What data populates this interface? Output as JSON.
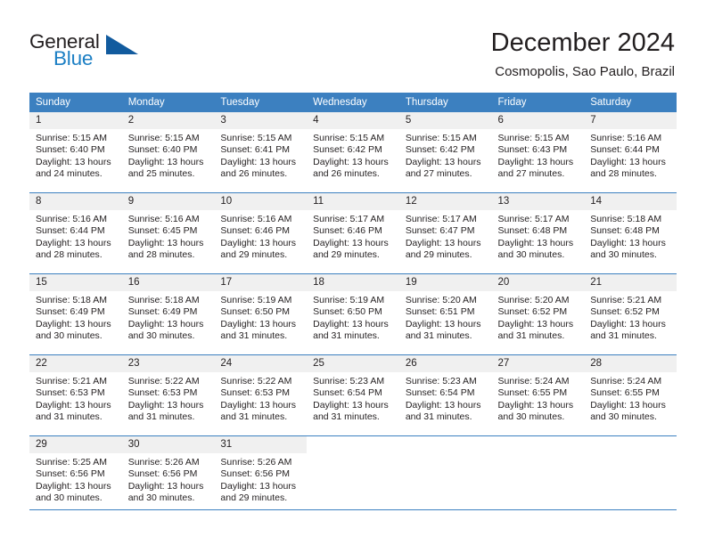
{
  "logo": {
    "word_one": "General",
    "word_two": "Blue",
    "triangle_color": "#125b9e",
    "blue_color": "#1c7fc4"
  },
  "header": {
    "title": "December 2024",
    "subtitle": "Cosmopolis, Sao Paulo, Brazil"
  },
  "theme": {
    "header_bg": "#3c80c0",
    "daynum_bg": "#f0f0f0",
    "text": "#231f20"
  },
  "weekday_headers": [
    "Sunday",
    "Monday",
    "Tuesday",
    "Wednesday",
    "Thursday",
    "Friday",
    "Saturday"
  ],
  "weeks": [
    [
      {
        "day": "1",
        "sunrise": "Sunrise: 5:15 AM",
        "sunset": "Sunset: 6:40 PM",
        "daylight1": "Daylight: 13 hours",
        "daylight2": "and 24 minutes."
      },
      {
        "day": "2",
        "sunrise": "Sunrise: 5:15 AM",
        "sunset": "Sunset: 6:40 PM",
        "daylight1": "Daylight: 13 hours",
        "daylight2": "and 25 minutes."
      },
      {
        "day": "3",
        "sunrise": "Sunrise: 5:15 AM",
        "sunset": "Sunset: 6:41 PM",
        "daylight1": "Daylight: 13 hours",
        "daylight2": "and 26 minutes."
      },
      {
        "day": "4",
        "sunrise": "Sunrise: 5:15 AM",
        "sunset": "Sunset: 6:42 PM",
        "daylight1": "Daylight: 13 hours",
        "daylight2": "and 26 minutes."
      },
      {
        "day": "5",
        "sunrise": "Sunrise: 5:15 AM",
        "sunset": "Sunset: 6:42 PM",
        "daylight1": "Daylight: 13 hours",
        "daylight2": "and 27 minutes."
      },
      {
        "day": "6",
        "sunrise": "Sunrise: 5:15 AM",
        "sunset": "Sunset: 6:43 PM",
        "daylight1": "Daylight: 13 hours",
        "daylight2": "and 27 minutes."
      },
      {
        "day": "7",
        "sunrise": "Sunrise: 5:16 AM",
        "sunset": "Sunset: 6:44 PM",
        "daylight1": "Daylight: 13 hours",
        "daylight2": "and 28 minutes."
      }
    ],
    [
      {
        "day": "8",
        "sunrise": "Sunrise: 5:16 AM",
        "sunset": "Sunset: 6:44 PM",
        "daylight1": "Daylight: 13 hours",
        "daylight2": "and 28 minutes."
      },
      {
        "day": "9",
        "sunrise": "Sunrise: 5:16 AM",
        "sunset": "Sunset: 6:45 PM",
        "daylight1": "Daylight: 13 hours",
        "daylight2": "and 28 minutes."
      },
      {
        "day": "10",
        "sunrise": "Sunrise: 5:16 AM",
        "sunset": "Sunset: 6:46 PM",
        "daylight1": "Daylight: 13 hours",
        "daylight2": "and 29 minutes."
      },
      {
        "day": "11",
        "sunrise": "Sunrise: 5:17 AM",
        "sunset": "Sunset: 6:46 PM",
        "daylight1": "Daylight: 13 hours",
        "daylight2": "and 29 minutes."
      },
      {
        "day": "12",
        "sunrise": "Sunrise: 5:17 AM",
        "sunset": "Sunset: 6:47 PM",
        "daylight1": "Daylight: 13 hours",
        "daylight2": "and 29 minutes."
      },
      {
        "day": "13",
        "sunrise": "Sunrise: 5:17 AM",
        "sunset": "Sunset: 6:48 PM",
        "daylight1": "Daylight: 13 hours",
        "daylight2": "and 30 minutes."
      },
      {
        "day": "14",
        "sunrise": "Sunrise: 5:18 AM",
        "sunset": "Sunset: 6:48 PM",
        "daylight1": "Daylight: 13 hours",
        "daylight2": "and 30 minutes."
      }
    ],
    [
      {
        "day": "15",
        "sunrise": "Sunrise: 5:18 AM",
        "sunset": "Sunset: 6:49 PM",
        "daylight1": "Daylight: 13 hours",
        "daylight2": "and 30 minutes."
      },
      {
        "day": "16",
        "sunrise": "Sunrise: 5:18 AM",
        "sunset": "Sunset: 6:49 PM",
        "daylight1": "Daylight: 13 hours",
        "daylight2": "and 30 minutes."
      },
      {
        "day": "17",
        "sunrise": "Sunrise: 5:19 AM",
        "sunset": "Sunset: 6:50 PM",
        "daylight1": "Daylight: 13 hours",
        "daylight2": "and 31 minutes."
      },
      {
        "day": "18",
        "sunrise": "Sunrise: 5:19 AM",
        "sunset": "Sunset: 6:50 PM",
        "daylight1": "Daylight: 13 hours",
        "daylight2": "and 31 minutes."
      },
      {
        "day": "19",
        "sunrise": "Sunrise: 5:20 AM",
        "sunset": "Sunset: 6:51 PM",
        "daylight1": "Daylight: 13 hours",
        "daylight2": "and 31 minutes."
      },
      {
        "day": "20",
        "sunrise": "Sunrise: 5:20 AM",
        "sunset": "Sunset: 6:52 PM",
        "daylight1": "Daylight: 13 hours",
        "daylight2": "and 31 minutes."
      },
      {
        "day": "21",
        "sunrise": "Sunrise: 5:21 AM",
        "sunset": "Sunset: 6:52 PM",
        "daylight1": "Daylight: 13 hours",
        "daylight2": "and 31 minutes."
      }
    ],
    [
      {
        "day": "22",
        "sunrise": "Sunrise: 5:21 AM",
        "sunset": "Sunset: 6:53 PM",
        "daylight1": "Daylight: 13 hours",
        "daylight2": "and 31 minutes."
      },
      {
        "day": "23",
        "sunrise": "Sunrise: 5:22 AM",
        "sunset": "Sunset: 6:53 PM",
        "daylight1": "Daylight: 13 hours",
        "daylight2": "and 31 minutes."
      },
      {
        "day": "24",
        "sunrise": "Sunrise: 5:22 AM",
        "sunset": "Sunset: 6:53 PM",
        "daylight1": "Daylight: 13 hours",
        "daylight2": "and 31 minutes."
      },
      {
        "day": "25",
        "sunrise": "Sunrise: 5:23 AM",
        "sunset": "Sunset: 6:54 PM",
        "daylight1": "Daylight: 13 hours",
        "daylight2": "and 31 minutes."
      },
      {
        "day": "26",
        "sunrise": "Sunrise: 5:23 AM",
        "sunset": "Sunset: 6:54 PM",
        "daylight1": "Daylight: 13 hours",
        "daylight2": "and 31 minutes."
      },
      {
        "day": "27",
        "sunrise": "Sunrise: 5:24 AM",
        "sunset": "Sunset: 6:55 PM",
        "daylight1": "Daylight: 13 hours",
        "daylight2": "and 30 minutes."
      },
      {
        "day": "28",
        "sunrise": "Sunrise: 5:24 AM",
        "sunset": "Sunset: 6:55 PM",
        "daylight1": "Daylight: 13 hours",
        "daylight2": "and 30 minutes."
      }
    ],
    [
      {
        "day": "29",
        "sunrise": "Sunrise: 5:25 AM",
        "sunset": "Sunset: 6:56 PM",
        "daylight1": "Daylight: 13 hours",
        "daylight2": "and 30 minutes."
      },
      {
        "day": "30",
        "sunrise": "Sunrise: 5:26 AM",
        "sunset": "Sunset: 6:56 PM",
        "daylight1": "Daylight: 13 hours",
        "daylight2": "and 30 minutes."
      },
      {
        "day": "31",
        "sunrise": "Sunrise: 5:26 AM",
        "sunset": "Sunset: 6:56 PM",
        "daylight1": "Daylight: 13 hours",
        "daylight2": "and 29 minutes."
      },
      {
        "day": "",
        "sunrise": "",
        "sunset": "",
        "daylight1": "",
        "daylight2": ""
      },
      {
        "day": "",
        "sunrise": "",
        "sunset": "",
        "daylight1": "",
        "daylight2": ""
      },
      {
        "day": "",
        "sunrise": "",
        "sunset": "",
        "daylight1": "",
        "daylight2": ""
      },
      {
        "day": "",
        "sunrise": "",
        "sunset": "",
        "daylight1": "",
        "daylight2": ""
      }
    ]
  ]
}
